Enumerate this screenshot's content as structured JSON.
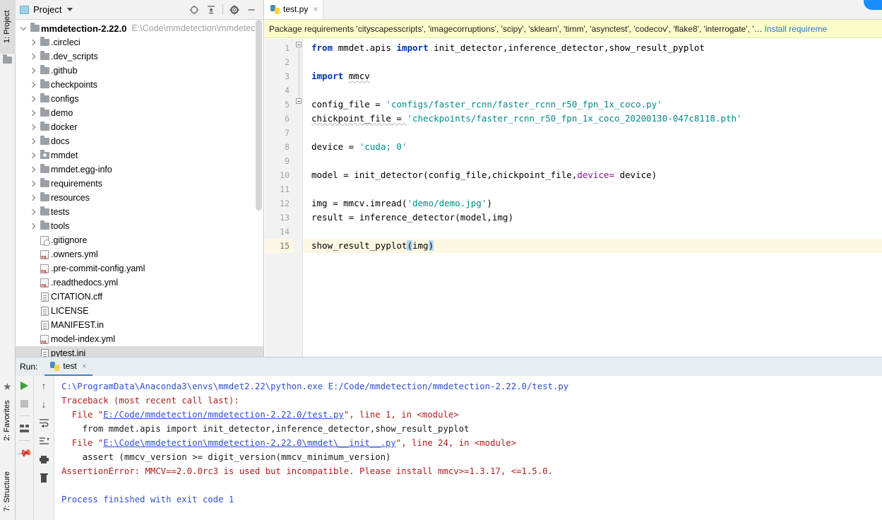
{
  "window": {
    "left_tabs": [
      {
        "label": "1: Project",
        "icon": "folder-icon",
        "active": true
      },
      {
        "label": "2: Favorites",
        "icon": "star-icon",
        "active": false
      },
      {
        "label": "7: Structure",
        "icon": "structure-icon",
        "active": false
      }
    ]
  },
  "project_panel": {
    "title": "Project",
    "toolbar": [
      {
        "name": "locate-file-icon",
        "glyph": "target"
      },
      {
        "name": "collapse-all-icon",
        "glyph": "collapse"
      },
      {
        "name": "settings-gear-icon",
        "glyph": "gear"
      },
      {
        "name": "hide-panel-icon",
        "glyph": "minus"
      }
    ],
    "root": {
      "label": "mmdetection-2.22.0",
      "path": "E:\\Code\\mmdetection\\mmdetec"
    },
    "items": [
      {
        "label": ".circleci",
        "type": "folder",
        "indent": 2,
        "expandable": true
      },
      {
        "label": ".dev_scripts",
        "type": "folder",
        "indent": 2,
        "expandable": true
      },
      {
        "label": ".github",
        "type": "folder",
        "indent": 2,
        "expandable": true
      },
      {
        "label": "checkpoints",
        "type": "folder",
        "indent": 2,
        "expandable": true
      },
      {
        "label": "configs",
        "type": "folder",
        "indent": 2,
        "expandable": true
      },
      {
        "label": "demo",
        "type": "folder",
        "indent": 2,
        "expandable": true
      },
      {
        "label": "docker",
        "type": "folder",
        "indent": 2,
        "expandable": true
      },
      {
        "label": "docs",
        "type": "folder",
        "indent": 2,
        "expandable": true
      },
      {
        "label": "mmdet",
        "type": "source-folder",
        "indent": 2,
        "expandable": true
      },
      {
        "label": "mmdet.egg-info",
        "type": "folder",
        "indent": 2,
        "expandable": true
      },
      {
        "label": "requirements",
        "type": "folder",
        "indent": 2,
        "expandable": true
      },
      {
        "label": "resources",
        "type": "folder",
        "indent": 2,
        "expandable": true
      },
      {
        "label": "tests",
        "type": "folder",
        "indent": 2,
        "expandable": true
      },
      {
        "label": "tools",
        "type": "folder",
        "indent": 2,
        "expandable": true
      },
      {
        "label": ".gitignore",
        "type": "gitignore",
        "indent": 2,
        "expandable": false
      },
      {
        "label": ".owners.yml",
        "type": "yml",
        "indent": 2,
        "expandable": false
      },
      {
        "label": ".pre-commit-config.yaml",
        "type": "yml",
        "indent": 2,
        "expandable": false
      },
      {
        "label": ".readthedocs.yml",
        "type": "yml",
        "indent": 2,
        "expandable": false
      },
      {
        "label": "CITATION.cff",
        "type": "file",
        "indent": 2,
        "expandable": false
      },
      {
        "label": "LICENSE",
        "type": "file",
        "indent": 2,
        "expandable": false
      },
      {
        "label": "MANIFEST.in",
        "type": "file",
        "indent": 2,
        "expandable": false
      },
      {
        "label": "model-index.yml",
        "type": "yml",
        "indent": 2,
        "expandable": false
      },
      {
        "label": "pytest.ini",
        "type": "file",
        "indent": 2,
        "expandable": false,
        "selected": true
      }
    ]
  },
  "editor": {
    "tabs": [
      {
        "label": "test.py",
        "icon": "python-file-icon",
        "close": "×",
        "active": true
      }
    ],
    "notification": {
      "text": "Package requirements 'cityscapesscripts', 'imagecorruptions', 'scipy', 'sklearn', 'timm', 'asynctest', 'codecov', 'flake8', 'interrogate', '…",
      "link": "Install requireme"
    },
    "lines": [
      {
        "n": "1",
        "fold": "start",
        "tokens": [
          {
            "t": "from ",
            "c": "kw"
          },
          {
            "t": "mmdet.apis ",
            "c": "plain"
          },
          {
            "t": "import ",
            "c": "kw"
          },
          {
            "t": "init_detector,inference_detector,show_result_pyplot",
            "c": "plain"
          }
        ]
      },
      {
        "n": "2",
        "fold": "line",
        "tokens": []
      },
      {
        "n": "3",
        "fold": "start",
        "tokens": [
          {
            "t": "import ",
            "c": "kw"
          },
          {
            "t": "mmcv",
            "c": "plain wavy"
          }
        ]
      },
      {
        "n": "4",
        "fold": "none",
        "tokens": []
      },
      {
        "n": "5",
        "fold": "none",
        "tokens": [
          {
            "t": "config_file = ",
            "c": "plain"
          },
          {
            "t": "'configs/faster_rcnn/faster_rcnn_r50_fpn_1x_coco.py'",
            "c": "str"
          }
        ]
      },
      {
        "n": "6",
        "fold": "none",
        "tokens": [
          {
            "t": "chickpoint_file = ",
            "c": "plain wavy"
          },
          {
            "t": "'checkpoints/faster_rcnn_r50_fpn_1x_coco_20200130-047c8118.pth'",
            "c": "str"
          }
        ]
      },
      {
        "n": "7",
        "fold": "none",
        "tokens": []
      },
      {
        "n": "8",
        "fold": "none",
        "tokens": [
          {
            "t": "device = ",
            "c": "plain"
          },
          {
            "t": "'cuda; 0'",
            "c": "str"
          }
        ]
      },
      {
        "n": "9",
        "fold": "none",
        "tokens": []
      },
      {
        "n": "10",
        "fold": "none",
        "tokens": [
          {
            "t": "model = init_detector(config_file,chickpoint_file,",
            "c": "plain"
          },
          {
            "t": "device=",
            "c": "kwarg"
          },
          {
            "t": " device)",
            "c": "plain"
          }
        ]
      },
      {
        "n": "11",
        "fold": "none",
        "tokens": []
      },
      {
        "n": "12",
        "fold": "none",
        "tokens": [
          {
            "t": "img = mmcv.imread(",
            "c": "plain"
          },
          {
            "t": "'demo/demo.jpg'",
            "c": "str"
          },
          {
            "t": ")",
            "c": "plain"
          }
        ]
      },
      {
        "n": "13",
        "fold": "none",
        "tokens": [
          {
            "t": "result = inference_detector(model,img)",
            "c": "plain"
          }
        ]
      },
      {
        "n": "14",
        "fold": "none",
        "tokens": []
      },
      {
        "n": "15",
        "fold": "none",
        "current": true,
        "tokens": [
          {
            "t": "show_result_pyplot",
            "c": "plain"
          },
          {
            "t": "(",
            "c": "plain selhl"
          },
          {
            "t": "img",
            "c": "plain"
          },
          {
            "t": ")",
            "c": "plain selhl"
          }
        ]
      }
    ]
  },
  "run_panel": {
    "label": "Run:",
    "tab": {
      "label": "test",
      "icon": "python-file-icon",
      "close": "×"
    },
    "tools_left": [
      {
        "name": "rerun-button",
        "glyph": "play"
      },
      {
        "name": "stop-button",
        "glyph": "stop"
      },
      {
        "name": "layout-settings-button",
        "glyph": "layout"
      },
      {
        "name": "pin-tab-button",
        "glyph": "pin"
      }
    ],
    "tools_right": [
      {
        "name": "up-the-stack-trace-button",
        "glyph": "↑"
      },
      {
        "name": "down-the-stack-trace-button",
        "glyph": "↓"
      },
      {
        "name": "soft-wrap-button",
        "glyph": "wrap"
      },
      {
        "name": "scroll-to-end-button",
        "glyph": "scrollend"
      },
      {
        "name": "print-button",
        "glyph": "printer"
      },
      {
        "name": "clear-all-button",
        "glyph": "trash"
      }
    ],
    "console": [
      {
        "segments": [
          {
            "t": "C:\\ProgramData\\Anaconda3\\envs\\mmdet2.22\\python.exe E:/Code/mmdetection/mmdetection-2.22.0/test.py",
            "c": "c-blue"
          }
        ]
      },
      {
        "segments": [
          {
            "t": "Traceback (most recent call last):",
            "c": "c-red"
          }
        ]
      },
      {
        "segments": [
          {
            "t": "  File \"",
            "c": "c-red"
          },
          {
            "t": "E:/Code/mmdetection/mmdetection-2.22.0/test.py",
            "c": "c-link"
          },
          {
            "t": "\", line 1, in <module>",
            "c": "c-red"
          }
        ]
      },
      {
        "segments": [
          {
            "t": "    from mmdet.apis import init_detector,inference_detector,show_result_pyplot",
            "c": "c-dark"
          }
        ]
      },
      {
        "segments": [
          {
            "t": "  File \"",
            "c": "c-red"
          },
          {
            "t": "E:\\Code\\mmdetection\\mmdetection-2.22.0\\mmdet\\__init__.py",
            "c": "c-link"
          },
          {
            "t": "\", line 24, in <module>",
            "c": "c-red"
          }
        ]
      },
      {
        "segments": [
          {
            "t": "    assert (mmcv_version >= digit_version(mmcv_minimum_version)",
            "c": "c-dark"
          }
        ]
      },
      {
        "segments": [
          {
            "t": "AssertionError: MMCV==2.0.0rc3 is used but incompatible. Please install mmcv>=1.3.17, <=1.5.0.",
            "c": "c-red"
          }
        ]
      },
      {
        "segments": [
          {
            "t": "",
            "c": "c-dark"
          }
        ]
      },
      {
        "segments": [
          {
            "t": "Process finished with exit code 1",
            "c": "c-blue"
          }
        ]
      }
    ]
  },
  "colors": {
    "keyword": "#0033b3",
    "string": "#018a8a",
    "kwarg": "#871094",
    "notification_bg": "#fdfdcc",
    "link": "#2e74c8",
    "current_line": "#fdf8e3",
    "error_red": "#b01e1e",
    "console_blue": "#2f4fd0",
    "accent_blue": "#3c7fd0"
  }
}
